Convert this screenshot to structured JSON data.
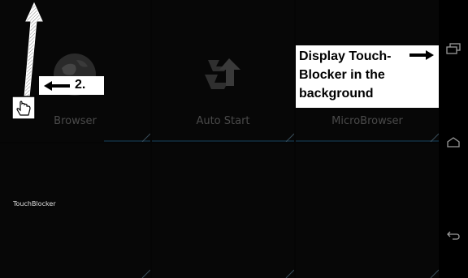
{
  "apps": [
    {
      "label": "Browser"
    },
    {
      "label": "Auto Start"
    },
    {
      "label": "MicroBrowser"
    }
  ],
  "touchblocker": {
    "label": "TouchBlocker"
  },
  "callouts": {
    "step": "2.",
    "main": "Display Touch-Blocker in the background"
  },
  "icons": {
    "browser": "globe-icon",
    "autostart": "autostart-icon",
    "hand": "hand-cursor-icon",
    "recent": "recent-apps-icon",
    "home": "home-icon",
    "back": "back-icon"
  }
}
